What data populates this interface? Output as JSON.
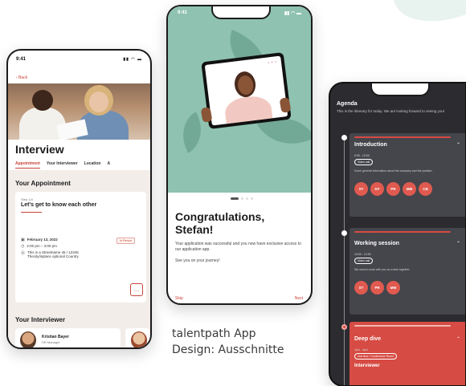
{
  "caption": {
    "line1": "talentpath App",
    "line2": "Design: Ausschnitte"
  },
  "phone1": {
    "time": "9:41",
    "status_icons": "▮▮ ◠ ▬",
    "back": "‹ Back",
    "title": "Interview",
    "tabs": [
      "Appointment",
      "Your Interviewer",
      "Location",
      "A"
    ],
    "section_title": "Your Appointment",
    "step": "Step 1/4",
    "card_heading": "Let's get to know each other",
    "date": "February 13, 2022",
    "time_range": "2:00 pm – 3:00 pm",
    "location": "This is a Streetname 45 / 12345 Thecity/isplace optional Country",
    "badge": "In Person",
    "more": "…",
    "interviewer_title": "Your Interviewer",
    "interviewer_name": "Kristian Bayer",
    "interviewer_role": "HR Manager",
    "accent": "#c8433a"
  },
  "phone2": {
    "time": "9:41",
    "status_icons": "▮▮ ◠ ▬",
    "screen_dots": "• • •",
    "heading": "Congratulations, Stefan!",
    "body": "Your application was successful and you now have exclusive access to our application app.",
    "body2": "See you on your journey!",
    "skip": "Skip",
    "next": "Next",
    "hero_color": "#8fc2b1"
  },
  "phone3": {
    "title": "Agenda",
    "subtitle": "This is the itinerary for today. We are looking forward to seeing you!",
    "blocks": [
      {
        "title": "Introduction",
        "time": "9:00 - 10:00",
        "tag": "Video call",
        "desc": "Some general information about the company and the position.",
        "avatars": [
          "ST",
          "KF",
          "PR",
          "MM",
          "CB"
        ]
      },
      {
        "title": "Working session",
        "time": "10:00 - 12:00",
        "tag": "Video call",
        "desc": "We want to work with you on a task together.",
        "avatars": [
          "ST",
          "PR",
          "MM"
        ]
      },
      {
        "title": "Deep dive",
        "time": "1pm - 3pm",
        "tag": "2nd floor / Conference Room",
        "sub": "Interviewer"
      }
    ],
    "chevron": "⌃"
  }
}
